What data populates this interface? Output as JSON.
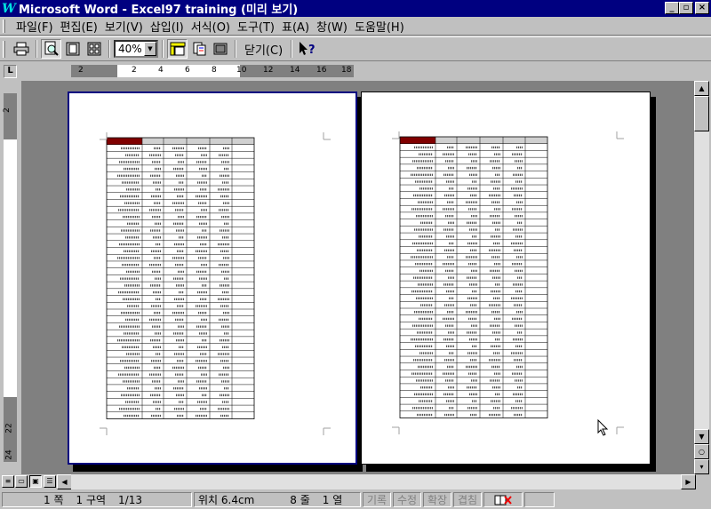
{
  "window": {
    "app_icon": "W",
    "title": "Microsoft Word - Excel97 training (미리 보기)",
    "btn_min": "_",
    "btn_max": "▫",
    "btn_close": "×"
  },
  "menu": [
    {
      "label": "파일(F)"
    },
    {
      "label": "편집(E)"
    },
    {
      "label": "보기(V)"
    },
    {
      "label": "삽입(I)"
    },
    {
      "label": "서식(O)"
    },
    {
      "label": "도구(T)"
    },
    {
      "label": "표(A)"
    },
    {
      "label": "창(W)"
    },
    {
      "label": "도움말(H)"
    }
  ],
  "toolbar": {
    "zoom_value": "40%",
    "close_label": "닫기(C)",
    "icons": [
      "print-icon",
      "magnifier-icon",
      "one-page-icon",
      "multiple-pages-icon",
      "view-ruler-icon",
      "shrink-to-fit-icon",
      "full-screen-icon",
      "context-help-icon"
    ]
  },
  "ruler": {
    "tab_marker": "L",
    "h_ticks": [
      "2",
      "2",
      "4",
      "6",
      "8",
      "10",
      "12",
      "14",
      "16",
      "18"
    ],
    "v_ticks": [
      "2",
      "22",
      "24"
    ]
  },
  "pages": {
    "count": 2,
    "page1_table_rows": 40,
    "page2_table_rows": 40
  },
  "statusbar": {
    "page": "1 쪽",
    "section": "1 구역",
    "page_of": "1/13",
    "position": "위치 6.4cm",
    "line": "8 줄",
    "col": "1 열",
    "rec": "기록",
    "trk": "수정",
    "ext": "확장",
    "ovr": "겹침"
  }
}
